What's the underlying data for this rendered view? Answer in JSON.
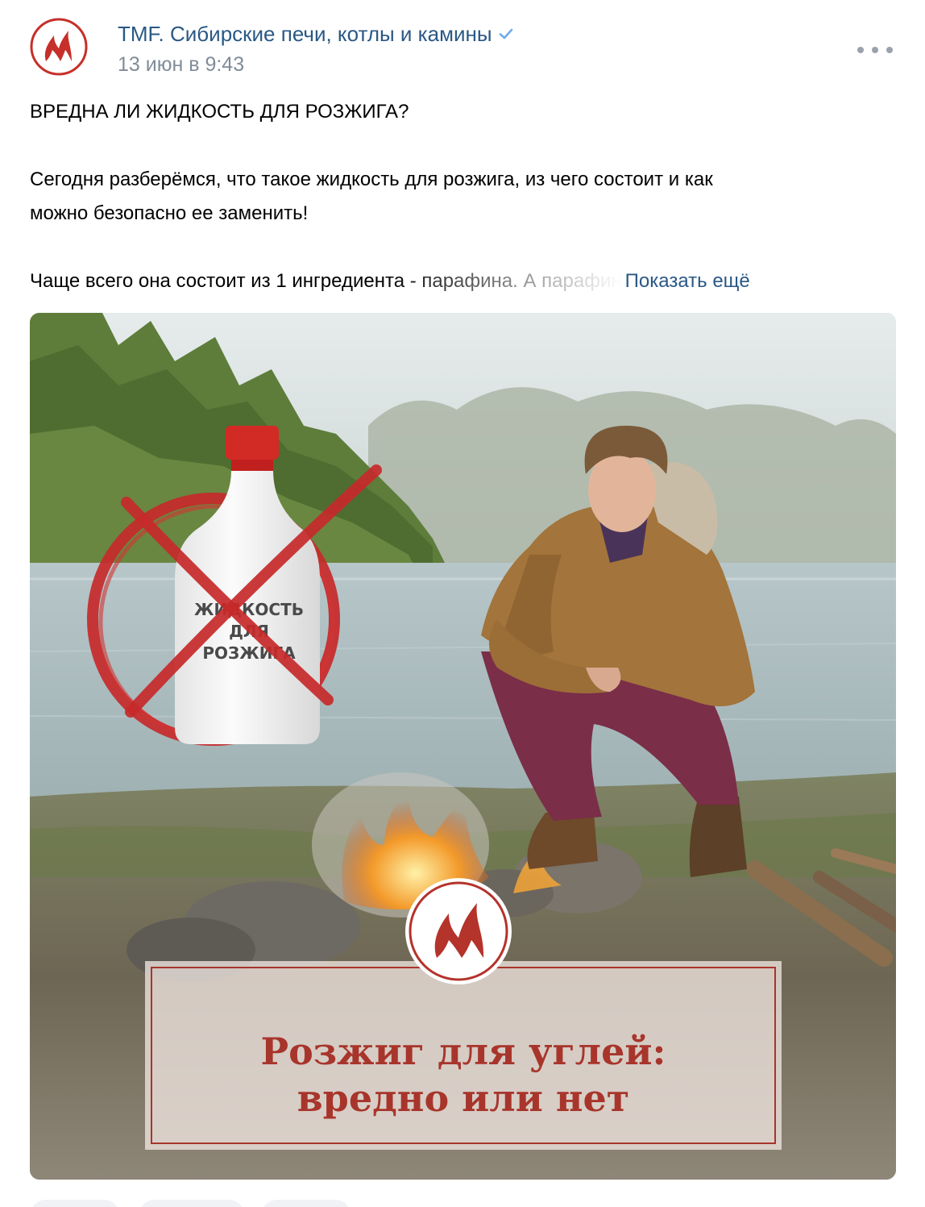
{
  "author": {
    "name": "TMF. Сибирские печи, котлы и камины",
    "date": "13 июн в 9:43",
    "verified": true
  },
  "post": {
    "headline": "ВРЕДНА ЛИ ЖИДКОСТЬ ДЛЯ РОЗЖИГА?",
    "paragraph1_line1": "Сегодня разберёмся, что такое жидкость для розжига, из чего состоит и как",
    "paragraph1_line2": "можно безопасно ее заменить!",
    "paragraph2_visible": "Чаще всего она состоит из 1 ингредиента - парафина. А парафин",
    "show_more_label": "Показать ещё"
  },
  "image": {
    "bottle_label_line1": "ЖИДКОСТЬ",
    "bottle_label_line2": "ДЛЯ",
    "bottle_label_line3": "РОЗЖИГА",
    "banner_line1": "Розжиг для углей:",
    "banner_line2": "вредно или нет"
  },
  "icons": {
    "avatar": "flame-logo-icon",
    "verified": "checkmark-icon",
    "more": "more-horizontal-icon"
  },
  "colors": {
    "link": "#2a5885",
    "meta": "#818c99",
    "brand_red": "#c0302b",
    "banner_text": "#a8352b"
  }
}
